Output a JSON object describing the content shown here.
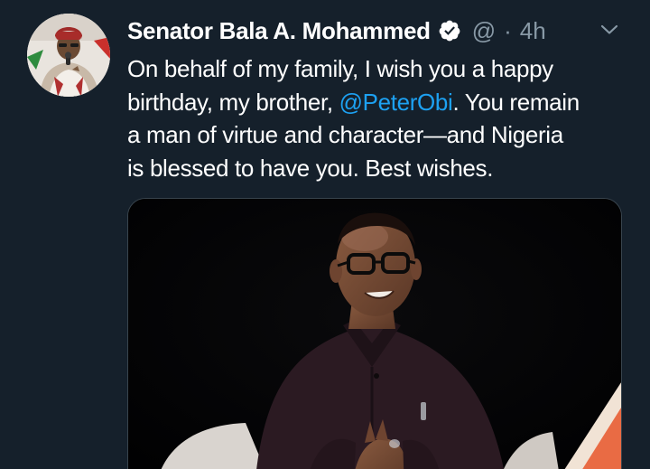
{
  "tweet": {
    "author": {
      "name": "Senator Bala A. Mohammed",
      "handle": "@",
      "verified": true,
      "verified_icon": "verified-badge-icon",
      "avatar": "avatar-photo"
    },
    "separator": "·",
    "timestamp": "4h",
    "menu_icon": "chevron-down-icon",
    "text": {
      "line_1": "On behalf of my family, I wish you a happy",
      "line_2_before": "birthday, my brother, ",
      "mention": "@PeterObi",
      "line_2_after": ". You remain",
      "line_3": "a man of virtue and character—and Nigeria",
      "line_4": "is blessed to have you. Best wishes."
    },
    "media": {
      "type": "photo",
      "description_icon": "photo-man-speaking"
    },
    "colors": {
      "background": "#15202b",
      "text": "#ffffff",
      "secondary": "#8899a6",
      "accent": "#1da1f2",
      "border": "#38444d"
    }
  }
}
